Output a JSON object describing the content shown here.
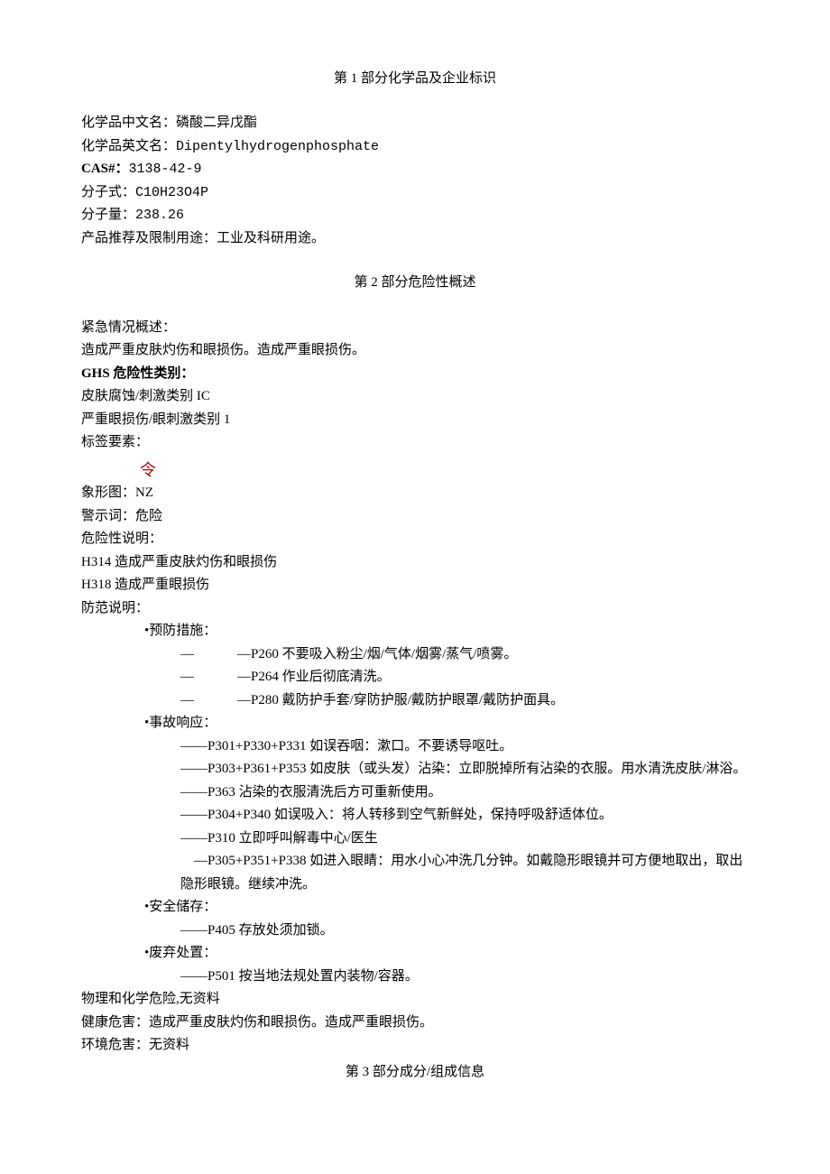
{
  "section1": {
    "title": "第 1 部分化学品及企业标识",
    "rows": {
      "name_cn_label": "化学品中文名：",
      "name_cn": "磷酸二异戊酯",
      "name_en_label": "化学品英文名：",
      "name_en": "Dipentylhydrogenphosphate",
      "cas_label": "CAS#：",
      "cas": "3138-42-9",
      "formula_label": "分子式：",
      "formula": "C10H23O4P",
      "mw_label": "分子量：",
      "mw": "238.26",
      "use_label": "产品推荐及限制用途：",
      "use": "工业及科研用途。"
    }
  },
  "section2": {
    "title": "第 2 部分危险性概述",
    "emergency_label": "紧急情况概述：",
    "emergency_text": "造成严重皮肤灼伤和眼损伤。造成严重眼损伤。",
    "ghs_label": "GHS 危险性类别：",
    "ghs_cat1": "皮肤腐蚀/刺激类别 IC",
    "ghs_cat2": "严重眼损伤/眼刺激类别 1",
    "label_elements": "标签要素：",
    "hazard_symbol": "令",
    "pictogram_label": "象形图：",
    "pictogram_value": "NZ",
    "signal_label": "警示词：",
    "signal_value": "危险",
    "hazard_stmt_label": "危险性说明：",
    "h314": "H314 造成严重皮肤灼伤和眼损伤",
    "h318": "H318 造成严重眼损伤",
    "precaution_label": "防范说明：",
    "prevention_title": "•预防措施：",
    "prevention": {
      "p260": "—P260 不要吸入粉尘/烟/气体/烟雾/蒸气/喷雾。",
      "p264": "—P264 作业后彻底清洗。",
      "p280": "—P280 戴防护手套/穿防护服/戴防护眼罩/戴防护面具。"
    },
    "response_title": "•事故响应：",
    "response": {
      "p301": "——P301+P330+P331 如误吞咽：漱口。不要诱导呕吐。",
      "p303": "——P303+P361+P353 如皮肤（或头发）沾染：立即脱掉所有沾染的衣服。用水清洗皮肤/淋浴。",
      "p363": "——P363 沾染的衣服清洗后方可重新使用。",
      "p304": "——P304+P340 如误吸入：将人转移到空气新鲜处，保持呼吸舒适体位。",
      "p310": "——P310 立即呼叫解毒中心/医生",
      "p305": "　—P305+P351+P338 如进入眼睛：用水小心冲洗几分钟。如戴隐形眼镜并可方便地取出，取出隐形眼镜。继续冲洗。"
    },
    "storage_title": "•安全储存：",
    "storage_p405": "——P405 存放处须加锁。",
    "disposal_title": "•废弃处置：",
    "disposal_p501": "——P501 按当地法规处置内装物/容器。",
    "phys_chem_label": "物理和化学危险,",
    "phys_chem_value": "无资料",
    "health_label": "健康危害：",
    "health_value": "造成严重皮肤灼伤和眼损伤。造成严重眼损伤。",
    "env_label": "环境危害：",
    "env_value": "无资料"
  },
  "section3": {
    "title": "第 3 部分成分/组成信息"
  },
  "dash": "—"
}
